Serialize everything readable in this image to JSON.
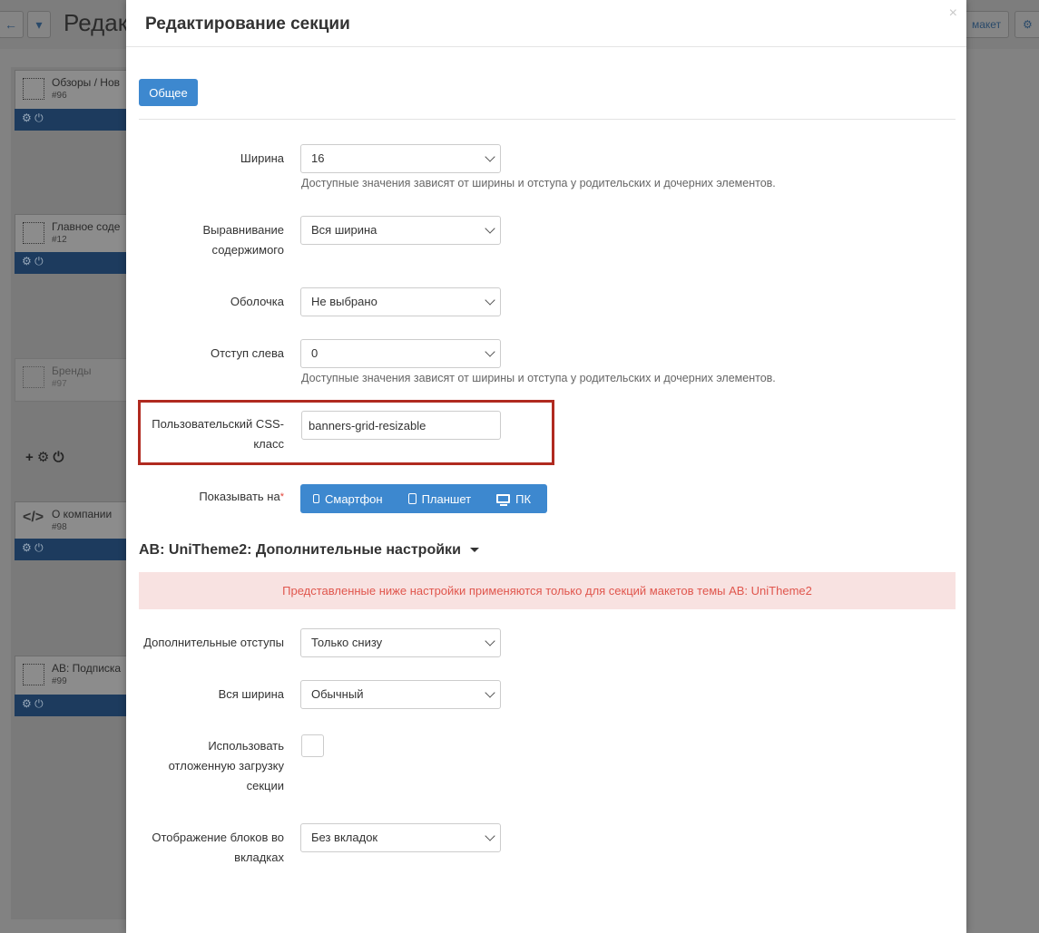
{
  "background": {
    "page_title": "Редакт",
    "right_button_label": "макет",
    "blocks": [
      {
        "name": "Обзоры / Нов",
        "num": "#96"
      },
      {
        "name": "Главное соде",
        "num": "#12"
      },
      {
        "name": "Бренды",
        "num": "#97"
      },
      {
        "name": "О компании",
        "num": "#98"
      },
      {
        "name": "AB: Подписка",
        "num": "#99"
      }
    ]
  },
  "modal": {
    "title": "Редактирование секции",
    "close_glyph": "×",
    "tabs": [
      {
        "label": "Общее"
      }
    ],
    "fields": {
      "width": {
        "label": "Ширина",
        "value": "16",
        "help": "Доступные значения зависят от ширины и отступа у родительских и дочерних элементов."
      },
      "align": {
        "label_line1": "Выравнивание",
        "label_line2": "содержимого",
        "value": "Вся ширина"
      },
      "wrapper": {
        "label": "Оболочка",
        "value": "Не выбрано"
      },
      "offset": {
        "label": "Отступ слева",
        "value": "0",
        "help": "Доступные значения зависят от ширины и отступа у родительских и дочерних элементов."
      },
      "css_class": {
        "label_line1": "Пользовательский CSS-",
        "label_line2": "класс",
        "value": "banners-grid-resizable"
      },
      "show_on": {
        "label": "Показывать на",
        "required": "*",
        "devices": [
          "Смартфон",
          "Планшет",
          "ПК"
        ]
      }
    },
    "addon": {
      "title": "AB: UniTheme2: Дополнительные настройки",
      "alert": "Представленные ниже настройки применяются только для секций макетов темы AB: UniTheme2",
      "fields": {
        "padding": {
          "label": "Дополнительные отступы",
          "value": "Только снизу"
        },
        "full_width": {
          "label": "Вся ширина",
          "value": "Обычный"
        },
        "lazy": {
          "label_line1": "Использовать",
          "label_line2": "отложенную загрузку",
          "label_line3": "секции",
          "checked": false
        },
        "tabs_display": {
          "label_line1": "Отображение блоков во",
          "label_line2": "вкладках",
          "value": "Без вкладок"
        }
      }
    }
  }
}
